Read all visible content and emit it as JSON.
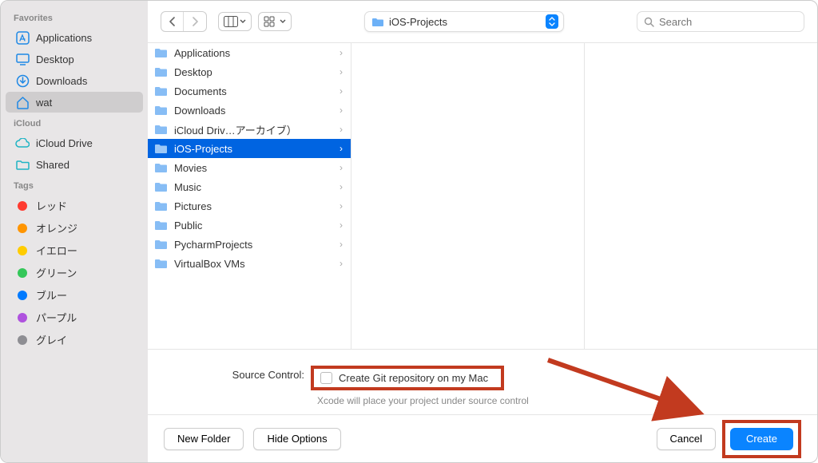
{
  "sidebar": {
    "sections": [
      {
        "header": "Favorites",
        "items": [
          {
            "label": "Applications",
            "icon": "app"
          },
          {
            "label": "Desktop",
            "icon": "desktop"
          },
          {
            "label": "Downloads",
            "icon": "downloads"
          },
          {
            "label": "wat",
            "icon": "home",
            "selected": true
          }
        ]
      },
      {
        "header": "iCloud",
        "items": [
          {
            "label": "iCloud Drive",
            "icon": "cloud"
          },
          {
            "label": "Shared",
            "icon": "shared"
          }
        ]
      },
      {
        "header": "Tags",
        "items": [
          {
            "label": "レッド",
            "icon": "tag",
            "color": "#ff3b30"
          },
          {
            "label": "オレンジ",
            "icon": "tag",
            "color": "#ff9500"
          },
          {
            "label": "イエロー",
            "icon": "tag",
            "color": "#ffcc00"
          },
          {
            "label": "グリーン",
            "icon": "tag",
            "color": "#34c759"
          },
          {
            "label": "ブルー",
            "icon": "tag",
            "color": "#007aff"
          },
          {
            "label": "パープル",
            "icon": "tag",
            "color": "#af52de"
          },
          {
            "label": "グレイ",
            "icon": "tag",
            "color": "#8e8e93"
          }
        ]
      }
    ]
  },
  "toolbar": {
    "location": "iOS-Projects",
    "search_placeholder": "Search"
  },
  "column1": [
    {
      "label": "Applications"
    },
    {
      "label": "Desktop"
    },
    {
      "label": "Documents"
    },
    {
      "label": "Downloads"
    },
    {
      "label": "iCloud Driv…アーカイブ）"
    },
    {
      "label": "iOS-Projects",
      "selected": true
    },
    {
      "label": "Movies"
    },
    {
      "label": "Music"
    },
    {
      "label": "Pictures"
    },
    {
      "label": "Public"
    },
    {
      "label": "PycharmProjects"
    },
    {
      "label": "VirtualBox VMs"
    }
  ],
  "options": {
    "source_control_label": "Source Control:",
    "checkbox_label": "Create Git repository on my Mac",
    "hint": "Xcode will place your project under source control"
  },
  "footer": {
    "new_folder": "New Folder",
    "hide_options": "Hide Options",
    "cancel": "Cancel",
    "create": "Create"
  }
}
